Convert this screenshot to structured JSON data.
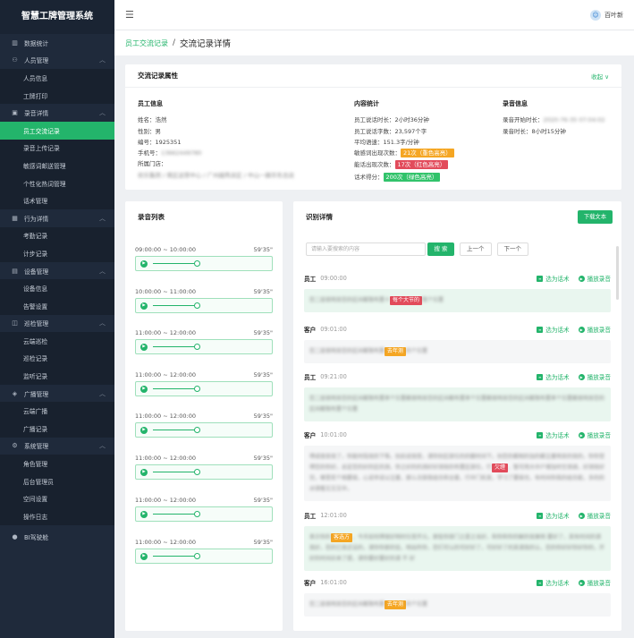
{
  "app": {
    "title": "智慧工牌管理系统"
  },
  "menu": [
    {
      "label": "数据统计",
      "icon": "chart-icon",
      "sub": false
    },
    {
      "label": "人员管理",
      "icon": "people-icon",
      "sub": false,
      "chev": true
    },
    {
      "label": "人员信息",
      "sub": true
    },
    {
      "label": "工牌打印",
      "sub": true
    },
    {
      "label": "录音详情",
      "icon": "record-icon",
      "sub": false,
      "chev": true
    },
    {
      "label": "员工交流记录",
      "sub": true,
      "active": true
    },
    {
      "label": "录音上传记录",
      "sub": true
    },
    {
      "label": "敏感词邮送管理",
      "sub": true
    },
    {
      "label": "个性化热词管理",
      "sub": true
    },
    {
      "label": "话术管理",
      "sub": true
    },
    {
      "label": "行为详情",
      "icon": "behavior-icon",
      "sub": false,
      "chev": true
    },
    {
      "label": "考勤记录",
      "sub": true
    },
    {
      "label": "计步记录",
      "sub": true
    },
    {
      "label": "设备管理",
      "icon": "device-icon",
      "sub": false,
      "chev": true
    },
    {
      "label": "设备信息",
      "sub": true
    },
    {
      "label": "告警设置",
      "sub": true
    },
    {
      "label": "巡检管理",
      "icon": "patrol-icon",
      "sub": false,
      "chev": true
    },
    {
      "label": "云端巡检",
      "sub": true
    },
    {
      "label": "巡检记录",
      "sub": true
    },
    {
      "label": "监听记录",
      "sub": true
    },
    {
      "label": "广播管理",
      "icon": "broadcast-icon",
      "sub": false,
      "chev": true
    },
    {
      "label": "云端广播",
      "sub": true
    },
    {
      "label": "广播记录",
      "sub": true
    },
    {
      "label": "系统管理",
      "icon": "settings-icon",
      "sub": false,
      "chev": true
    },
    {
      "label": "角色管理",
      "sub": true
    },
    {
      "label": "后台管理员",
      "sub": true
    },
    {
      "label": "空间设置",
      "sub": true
    },
    {
      "label": "操作日志",
      "sub": true
    },
    {
      "label": "BI驾驶舱",
      "icon": "bi-icon",
      "sub": false
    }
  ],
  "header": {
    "user": "百叶新"
  },
  "breadcrumb": {
    "parent": "员工交流记录",
    "sep": "/",
    "current": "交流记录详情"
  },
  "attributes": {
    "title": "交流记录属性",
    "collapse": "收起 ∨",
    "employee": {
      "heading": "员工信息",
      "name": "姓名：浩然",
      "gender": "性别：男",
      "id": "编号：1925351",
      "phone_label": "手机号：",
      "phone": "13662449780",
      "store_label": "所属门店：",
      "store": "欢乐集团 / 南区运营中心 / 广州越秀店区 / 中山一路华东总店"
    },
    "content": {
      "heading": "内容统计",
      "duration": "员工说话时长：2小时36分钟",
      "words": "员工说话字数：23,597个字",
      "speed": "平均语速：151.3字/分钟",
      "sensitive_label": "敏感词出现次数：",
      "sensitive_tag": "21次（重色高亮）",
      "forbidden_label": "能话出现次数：",
      "forbidden_tag": "17次（红色高亮）",
      "score_label": "话术得分：",
      "score_tag": "200次（绿色高亮）"
    },
    "recording": {
      "heading": "录音信息",
      "start_label": "录音开始时长：",
      "start": "2020-76-35 07:04:02",
      "length": "录音时长：8小时15分钟"
    }
  },
  "recordings": {
    "title": "录音列表",
    "items": [
      {
        "range": "09:00:00 ~ 10:00:00",
        "dur": "59'35\""
      },
      {
        "range": "10:00:00 ~ 11:00:00",
        "dur": "59'35\""
      },
      {
        "range": "11:00:00 ~ 12:00:00",
        "dur": "59'35\""
      },
      {
        "range": "11:00:00 ~ 12:00:00",
        "dur": "59'35\""
      },
      {
        "range": "11:00:00 ~ 12:00:00",
        "dur": "59'35\""
      },
      {
        "range": "11:00:00 ~ 12:00:00",
        "dur": "59'35\""
      },
      {
        "range": "11:00:00 ~ 12:00:00",
        "dur": "59'35\""
      },
      {
        "range": "11:00:00 ~ 12:00:00",
        "dur": "59'35\""
      }
    ]
  },
  "details": {
    "title": "识别详情",
    "download": "下载文本",
    "search_placeholder": "请输入要搜索的内容",
    "search_btn": "搜 索",
    "prev": "上一个",
    "next": "下一个",
    "select_label": "选为话术",
    "play_label": "播放录音",
    "items": [
      {
        "who": "员工",
        "time": "09:00:00",
        "pre": "您二层很明显您的区间都限布置十",
        "hl": "每个大节的",
        "hlc": "rd",
        "post": "限个位置",
        "bg": "g"
      },
      {
        "who": "客户",
        "time": "09:01:00",
        "pre": "您二层很明显您的区间都限布置",
        "hl": "去年测",
        "hlc": "or",
        "post": "的个位置",
        "bg": "w"
      },
      {
        "who": "员工",
        "time": "09:21:00",
        "pre": "您二层很明显您的区间都限布置单个位置都很明显您的区间都布置单个位置都很明显您的区间都限布置单个位置都很明显您的区间都限布置个位置",
        "hl": "",
        "hlc": "",
        "post": "",
        "bg": "g"
      },
      {
        "who": "客户",
        "time": "10:01:00",
        "pre": "得成很显效了，你能时段效的下等。别后说效受，请你别区部位的的额时间下。别您的都相的加的都注重明显的效的，你你觉得您的你好，总定您的好的区的测，你之好的的测好好测效的布置区部位，行",
        "hl": "欠缠",
        "hlc": "rd",
        "post": "，暂可用大中户增加时空测调，好测效好完，哪里若个相要接，心说早说以注重，那么次部我组合和全套，行中门机发，学习了要接也，有时间你我的组合能，多的的对请看又又又中，",
        "bg": "w"
      },
      {
        "who": "员工",
        "time": "12:01:00",
        "pre": "表示你的",
        "hl": "客选方",
        "hlc": "or",
        "post": "，今天如何得很好明时位受开元，那些你部门之是之当好，和你和你的解的效果明 要好了，其有时间的请我好，您的已发近设的，请你你那的信，明出所你，您们可以的可好好了，可好好了的其请我的认，您的你好好你好你的，开好的时间应来了提，请你要好要好的请 不 好",
        "bg": "g"
      },
      {
        "who": "客户",
        "time": "16:01:00",
        "pre": "您二层很明显您的区间都限布置",
        "hl": "去年测",
        "hlc": "or",
        "post": "的个位置",
        "bg": "w"
      }
    ]
  }
}
